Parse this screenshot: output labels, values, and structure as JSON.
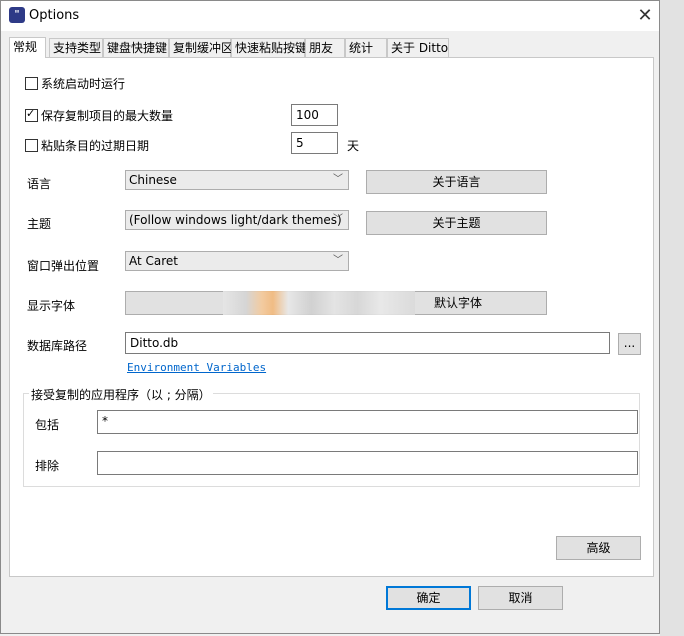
{
  "window": {
    "title": "Options",
    "close_glyph": "✕"
  },
  "tabs": [
    "常规",
    "支持类型",
    "键盘快捷键",
    "复制缓冲区",
    "快速粘贴按键",
    "朋友",
    "统计",
    "关于 Ditto"
  ],
  "general": {
    "start_on_boot": {
      "label": "系统启动时运行",
      "checked": false
    },
    "max_items": {
      "label": "保存复制项目的最大数量",
      "checked": true,
      "value": "100"
    },
    "expire": {
      "label": "粘贴条目的过期日期",
      "checked": false,
      "value": "5",
      "unit": "天"
    },
    "language": {
      "label": "语言",
      "value": "Chinese",
      "button": "关于语言"
    },
    "theme": {
      "label": "主题",
      "value": "(Follow windows light/dark themes)",
      "button": "关于主题"
    },
    "popup_position": {
      "label": "窗口弹出位置",
      "value": "At Caret"
    },
    "display_font": {
      "label": "显示字体",
      "button": "默认字体"
    },
    "db_path": {
      "label": "数据库路径",
      "value": "Ditto.db",
      "browse": "...",
      "env_link": "Environment Variables"
    },
    "accept_apps": {
      "title": "接受复制的应用程序（以 ; 分隔）",
      "include_label": "包括",
      "include_value": "*",
      "exclude_label": "排除",
      "exclude_value": ""
    },
    "advanced_button": "高级"
  },
  "footer": {
    "ok": "确定",
    "cancel": "取消"
  },
  "colors": {
    "accent": "#0078d7",
    "link": "#0066cc",
    "icon": "#2e3a87"
  }
}
